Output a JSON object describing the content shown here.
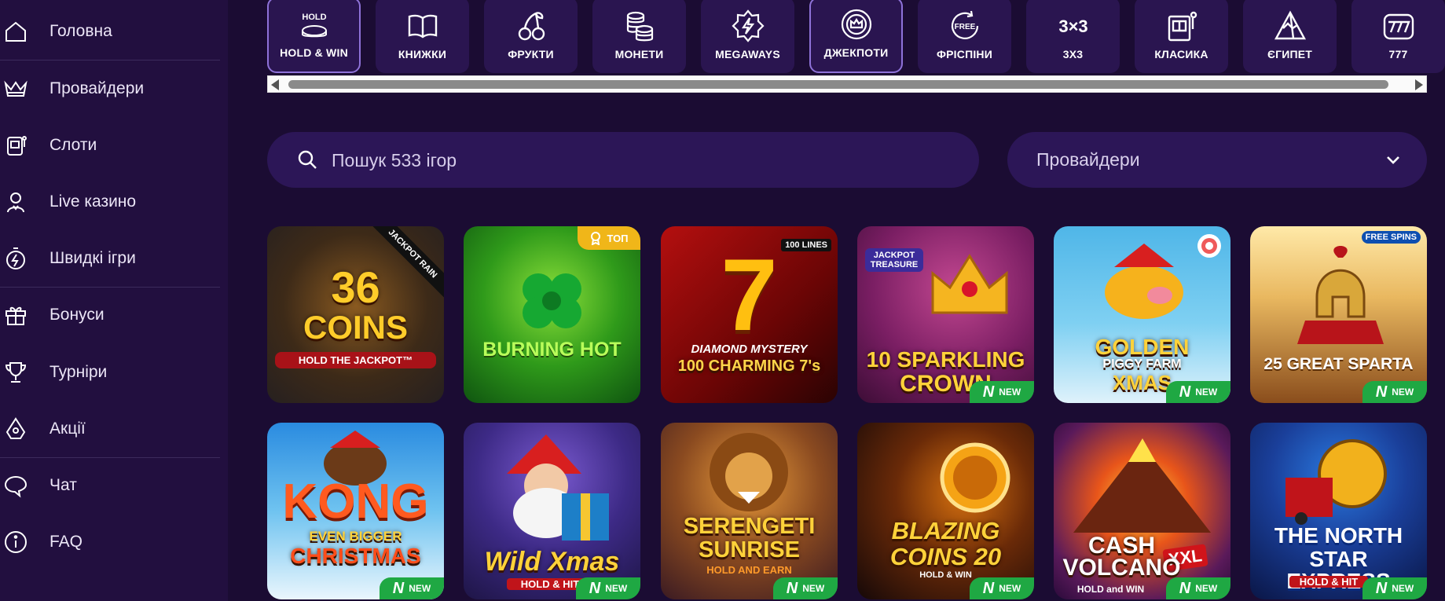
{
  "sidebar": {
    "items": [
      {
        "label": "Головна",
        "icon": "home-icon"
      },
      {
        "label": "Провайдери",
        "icon": "crown-icon"
      },
      {
        "label": "Слоти",
        "icon": "slot-machine-icon"
      },
      {
        "label": "Live казино",
        "icon": "dealer-icon"
      },
      {
        "label": "Швидкі ігри",
        "icon": "stopwatch-lightning-icon"
      },
      {
        "label": "Бонуси",
        "icon": "gift-icon"
      },
      {
        "label": "Турніри",
        "icon": "trophy-icon"
      },
      {
        "label": "Акції",
        "icon": "promo-tag-icon"
      },
      {
        "label": "Чат",
        "icon": "chat-bubble-icon"
      },
      {
        "label": "FAQ",
        "icon": "info-icon"
      }
    ]
  },
  "categories": [
    {
      "label": "HOLD & WIN",
      "icon": "hold-coins-icon",
      "icon_text": "HOLD",
      "active": true
    },
    {
      "label": "КНИЖКИ",
      "icon": "book-icon"
    },
    {
      "label": "ФРУКТИ",
      "icon": "cherry-icon"
    },
    {
      "label": "МОНЕТИ",
      "icon": "coins-stack-icon"
    },
    {
      "label": "MEGAWAYS",
      "icon": "megaways-bolt-icon"
    },
    {
      "label": "ДЖЕКПОТИ",
      "icon": "jackpot-crown-icon",
      "active": true
    },
    {
      "label": "ФРІСПІНИ",
      "icon": "free-spins-icon",
      "icon_text": "FREE"
    },
    {
      "label": "3X3",
      "icon": "grid-3x3-icon",
      "icon_text": "3×3"
    },
    {
      "label": "КЛАСИКА",
      "icon": "classic-slot-icon"
    },
    {
      "label": "ЄГИПЕТ",
      "icon": "pyramid-icon"
    },
    {
      "label": "777",
      "icon": "sevens-icon"
    }
  ],
  "search": {
    "placeholder": "Пошук 533 ігор"
  },
  "providers_dropdown": {
    "label": "Провайдери"
  },
  "badges": {
    "new": "NEW",
    "new_logo": "N",
    "top": "ТОП"
  },
  "games": [
    {
      "title_lines": [
        "36",
        "COINS"
      ],
      "subtitle": "HOLD THE JACKPOT™",
      "stripe": "JACKPOT RAIN"
    },
    {
      "title_lines": [
        "BURNING HOT"
      ],
      "badge": "top"
    },
    {
      "title_lines": [
        "100 CHARMING 7's"
      ],
      "subtitle": "DIAMOND MYSTERY",
      "corner": "100 LINES"
    },
    {
      "title_lines": [
        "10 SPARKLING",
        "CROWN"
      ],
      "corner": "JACKPOT TREASURE",
      "badge": "new"
    },
    {
      "title_lines": [
        "GOLDEN",
        "PIGGY FARM",
        "XMAS"
      ],
      "badge": "new"
    },
    {
      "title_lines": [
        "25 GREAT SPARTA"
      ],
      "corner": "FREE SPINS",
      "badge": "new"
    },
    {
      "title_lines": [
        "KONG",
        "EVEN BIGGER",
        "CHRISTMAS"
      ],
      "badge": "new"
    },
    {
      "title_lines": [
        "Wild Xmas"
      ],
      "subtitle": "HOLD & HIT",
      "badge": "new"
    },
    {
      "title_lines": [
        "SERENGETI",
        "SUNRISE"
      ],
      "subtitle": "HOLD AND EARN",
      "badge": "new"
    },
    {
      "title_lines": [
        "BLAZING",
        "COINS 20"
      ],
      "subtitle": "HOLD & WIN",
      "badge": "new"
    },
    {
      "title_lines": [
        "CASH",
        "VOLCANO"
      ],
      "subtitle": "HOLD and WIN",
      "corner": "XXL",
      "badge": "new"
    },
    {
      "title_lines": [
        "THE NORTH",
        "STAR EXPRESS"
      ],
      "subtitle": "HOLD & HIT",
      "badge": "new"
    }
  ]
}
